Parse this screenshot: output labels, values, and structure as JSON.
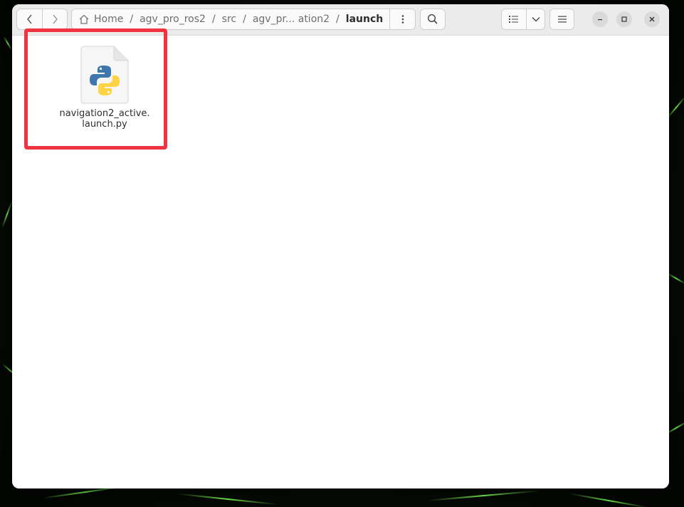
{
  "window": {
    "breadcrumbs": [
      {
        "label": "Home",
        "icon": "home-icon"
      },
      {
        "label": "agv_pro_ros2"
      },
      {
        "label": "src"
      },
      {
        "label": "agv_pr... ation2"
      },
      {
        "label": "launch",
        "current": true
      }
    ],
    "separator": "/"
  },
  "toolbar": {
    "back_icon": "chevron-left-icon",
    "forward_icon": "chevron-right-icon",
    "path_menu_icon": "vertical-dots-icon",
    "search_icon": "search-icon",
    "view_icon": "list-view-icon",
    "view_dropdown_icon": "chevron-down-icon",
    "main_menu_icon": "hamburger-icon"
  },
  "window_controls": [
    "minimize",
    "maximize",
    "close"
  ],
  "files": [
    {
      "name_line1": "navigation2_active.",
      "name_line2": "launch.py",
      "icon": "python-file-icon"
    }
  ],
  "colors": {
    "highlight": "#ef3340",
    "python_blue": "#3d77ad",
    "python_yellow": "#ffd343"
  }
}
